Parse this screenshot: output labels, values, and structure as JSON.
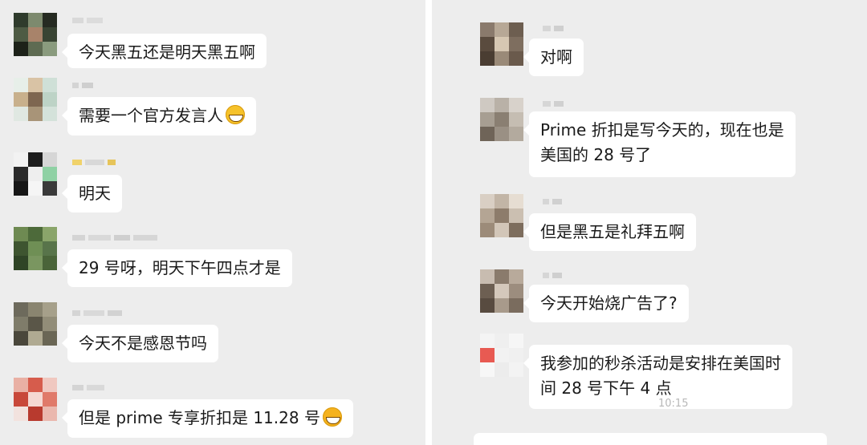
{
  "colors": {
    "chat_background": "#ededed",
    "bubble_background": "#ffffff",
    "text": "#1a1a1a",
    "divider": "#ffffff"
  },
  "left_panel": {
    "messages": [
      {
        "text": "今天黑五还是明天黑五啊",
        "emoji": null
      },
      {
        "text": "需要一个官方发言人",
        "emoji": "grinning-face-emoji"
      },
      {
        "text": "明天",
        "emoji": null
      },
      {
        "text": "29 号呀，明天下午四点才是",
        "emoji": null
      },
      {
        "text": "今天不是感恩节吗",
        "emoji": null
      },
      {
        "text": "但是 prime 专享折扣是 11.28 号",
        "emoji": "laughing-tears-emoji"
      }
    ]
  },
  "right_panel": {
    "messages": [
      {
        "lines": [
          "对啊"
        ]
      },
      {
        "lines": [
          "Prime 折扣是写今天的，现在也是",
          "美国的 28 号了"
        ]
      },
      {
        "lines": [
          "但是黑五是礼拜五啊"
        ]
      },
      {
        "lines": [
          "今天开始烧广告了?"
        ]
      },
      {
        "lines": [
          "我参加的秒杀活动是安排在美国时",
          "间 28 号下午 4 点"
        ]
      }
    ],
    "timestamp": "10:15"
  }
}
